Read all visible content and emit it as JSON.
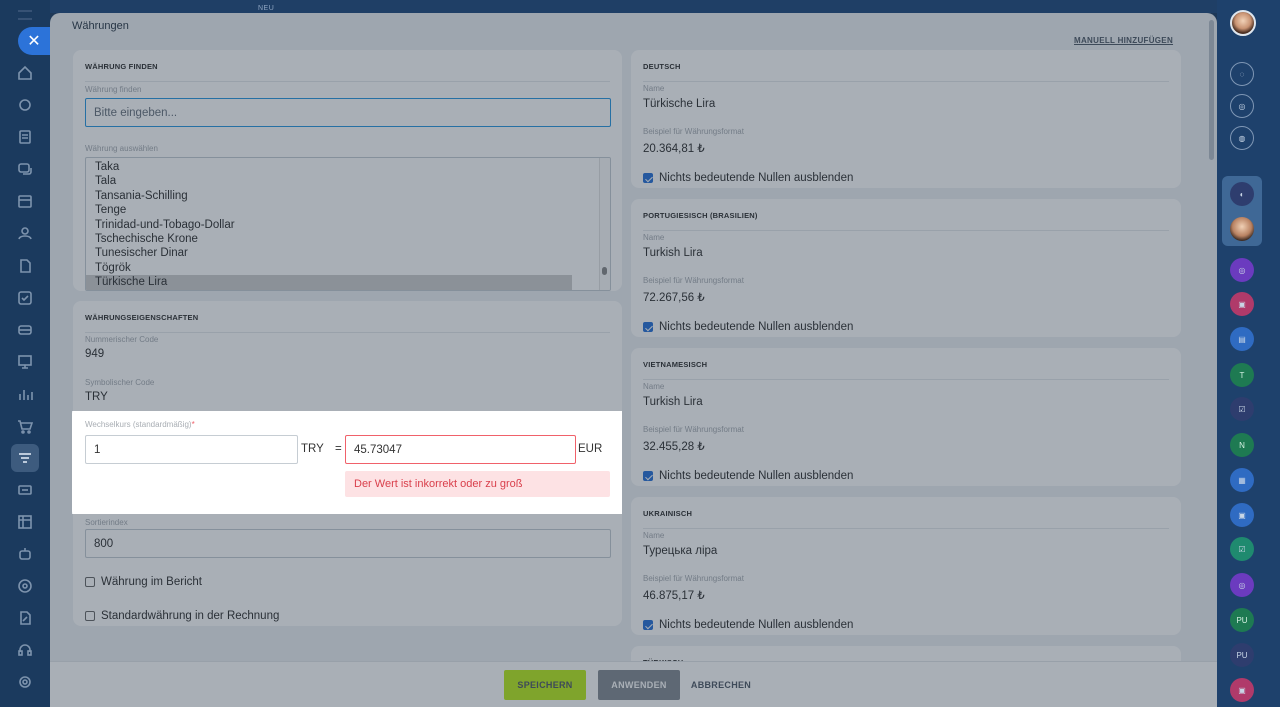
{
  "top": {
    "badge": "NEU"
  },
  "left_rail": {
    "icons": [
      "home-icon",
      "puzzle-icon",
      "document-icon",
      "chat-icon",
      "calendar-icon",
      "contacts-icon",
      "file-icon",
      "tasks-icon",
      "crm-icon",
      "board-icon",
      "analytics-icon",
      "cart-icon",
      "filter-icon",
      "card-icon",
      "scheduler-icon",
      "robot-icon",
      "target-icon",
      "edit-doc-icon",
      "headset-icon",
      "settings-icon"
    ],
    "active_index": 12
  },
  "right_rail": {
    "initials": [
      "T",
      "N",
      "PU",
      "PU"
    ]
  },
  "panel": {
    "title": "Währungen",
    "manual_add": "MANUELL HINZUFÜGEN"
  },
  "find": {
    "header": "WÄHRUNG FINDEN",
    "search_label": "Währung finden",
    "search_placeholder": "Bitte eingeben...",
    "select_label": "Währung auswählen",
    "options": [
      "Taka",
      "Tala",
      "Tansania-Schilling",
      "Tenge",
      "Trinidad-und-Tobago-Dollar",
      "Tschechische Krone",
      "Tunesischer Dinar",
      "Tögrök",
      "Türkische Lira"
    ],
    "selected": "Türkische Lira"
  },
  "props": {
    "header": "WÄHRUNGSEIGENSCHAFTEN",
    "num_code_label": "Nummerischer Code",
    "num_code": "949",
    "sym_code_label": "Symbolischer Code",
    "sym_code": "TRY",
    "rate_label": "Wechselkurs (standardmäßig)",
    "rate_required": "*",
    "rate_amount": "1",
    "rate_from": "TRY",
    "rate_equals": "=",
    "rate_value": "45.73047",
    "rate_to": "EUR",
    "rate_error": "Der Wert ist inkorrekt oder zu groß",
    "sort_label": "Sortierindex",
    "sort_value": "800",
    "in_report": "Währung im Bericht",
    "default_invoice": "Standardwährung in der Rechnung"
  },
  "languages": [
    {
      "header": "DEUTSCH",
      "name_label": "Name",
      "name": "Türkische Lira",
      "format_label": "Beispiel für Währungsformat",
      "format": "20.364,81 ₺",
      "hide_zeros": "Nichts bedeutende Nullen ausblenden"
    },
    {
      "header": "PORTUGIESISCH (BRASILIEN)",
      "name_label": "Name",
      "name": "Turkish Lira",
      "format_label": "Beispiel für Währungsformat",
      "format": "72.267,56 ₺",
      "hide_zeros": "Nichts bedeutende Nullen ausblenden"
    },
    {
      "header": "VIETNAMESISCH",
      "name_label": "Name",
      "name": "Turkish Lira",
      "format_label": "Beispiel für Währungsformat",
      "format": "32.455,28 ₺",
      "hide_zeros": "Nichts bedeutende Nullen ausblenden"
    },
    {
      "header": "UKRAINISCH",
      "name_label": "Name",
      "name": "Турецька ліра",
      "format_label": "Beispiel für Währungsformat",
      "format": "46.875,17 ₺",
      "hide_zeros": "Nichts bedeutende Nullen ausblenden"
    },
    {
      "header": "TÜRKISCH"
    }
  ],
  "footer": {
    "save": "SPEICHERN",
    "apply": "ANWENDEN",
    "cancel": "ABBRECHEN"
  },
  "colors": {
    "save_bg": "#bbed21",
    "apply_bg": "#868d95",
    "accent": "#2d9ae3",
    "error": "#f0616a"
  }
}
